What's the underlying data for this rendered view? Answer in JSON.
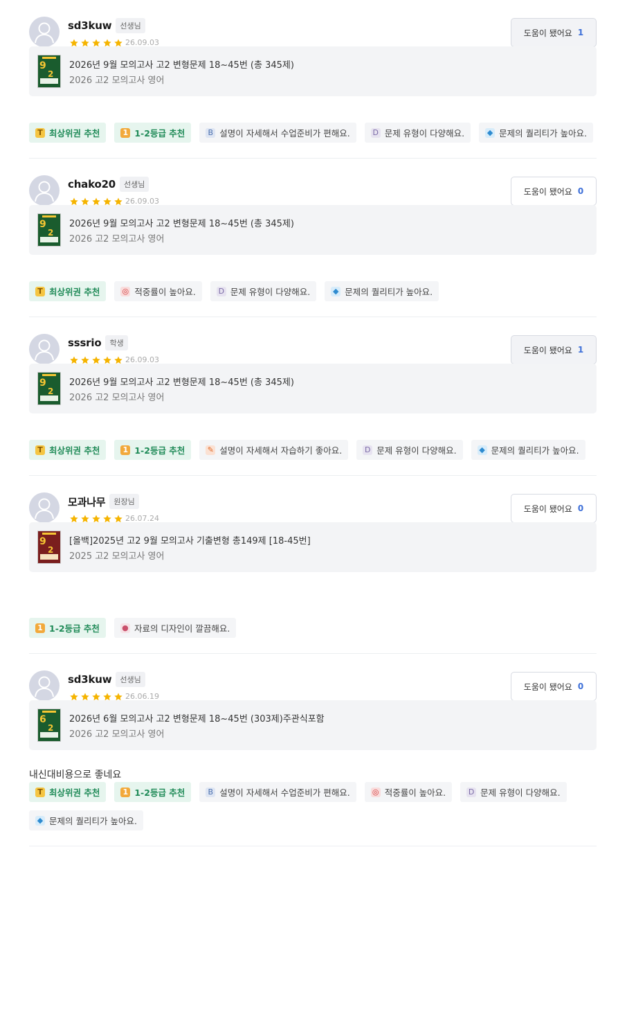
{
  "help_label": "도움이 됐어요",
  "reviews": [
    {
      "name": "sd3kuw",
      "role": "선생님",
      "date": "26.09.03",
      "rating": 5,
      "help_count": "1",
      "help_active": true,
      "product_title": "2026년 9월 모의고사 고2 변형문제 18~45번 (총 345제)",
      "product_subtitle": "2026 고2 모의고사 영어",
      "thumb_number": "9",
      "thumb_color": "green",
      "comment": "",
      "tags": [
        {
          "label": "최상위권 추천",
          "icon": "trophy-icon",
          "highlight": true
        },
        {
          "label": "1-2등급 추천",
          "icon": "medal-icon",
          "highlight": true
        },
        {
          "label": "설명이 자세해서 수업준비가 편해요.",
          "icon": "book-icon",
          "highlight": false
        },
        {
          "label": "문제 유형이 다양해요.",
          "icon": "dice-icon",
          "highlight": false
        },
        {
          "label": "문제의 퀄리티가 높아요.",
          "icon": "diamond-icon",
          "highlight": false
        }
      ]
    },
    {
      "name": "chako20",
      "role": "선생님",
      "date": "26.09.03",
      "rating": 5,
      "help_count": "0",
      "help_active": false,
      "product_title": "2026년 9월 모의고사 고2 변형문제 18~45번 (총 345제)",
      "product_subtitle": "2026 고2 모의고사 영어",
      "thumb_number": "9",
      "thumb_color": "green",
      "comment": "",
      "tags": [
        {
          "label": "최상위권 추천",
          "icon": "trophy-icon",
          "highlight": true
        },
        {
          "label": "적중률이 높아요.",
          "icon": "target-icon",
          "highlight": false
        },
        {
          "label": "문제 유형이 다양해요.",
          "icon": "dice-icon",
          "highlight": false
        },
        {
          "label": "문제의 퀄리티가 높아요.",
          "icon": "diamond-icon",
          "highlight": false
        }
      ]
    },
    {
      "name": "sssrio",
      "role": "학생",
      "date": "26.09.03",
      "rating": 5,
      "help_count": "1",
      "help_active": true,
      "product_title": "2026년 9월 모의고사 고2 변형문제 18~45번 (총 345제)",
      "product_subtitle": "2026 고2 모의고사 영어",
      "thumb_number": "9",
      "thumb_color": "green",
      "comment": "",
      "tags": [
        {
          "label": "최상위권 추천",
          "icon": "trophy-icon",
          "highlight": true
        },
        {
          "label": "1-2등급 추천",
          "icon": "medal-icon",
          "highlight": true
        },
        {
          "label": "설명이 자세해서 자습하기 좋아요.",
          "icon": "pencil-icon",
          "highlight": false
        },
        {
          "label": "문제 유형이 다양해요.",
          "icon": "dice-icon",
          "highlight": false
        },
        {
          "label": "문제의 퀄리티가 높아요.",
          "icon": "diamond-icon",
          "highlight": false
        }
      ]
    },
    {
      "name": "모과나무",
      "role": "원장님",
      "date": "26.07.24",
      "rating": 5,
      "help_count": "0",
      "help_active": false,
      "product_title": "[올백]2025년 고2 9월 모의고사 기출변형 총149제 [18-45번]",
      "product_subtitle": "2025 고2 모의고사 영어",
      "thumb_number": "9",
      "thumb_color": "red",
      "comment": " ",
      "tags": [
        {
          "label": "1-2등급 추천",
          "icon": "medal-icon",
          "highlight": true
        },
        {
          "label": "자료의 디자인이 깔끔해요.",
          "icon": "palette-icon",
          "highlight": false
        }
      ]
    },
    {
      "name": "sd3kuw",
      "role": "선생님",
      "date": "26.06.19",
      "rating": 5,
      "help_count": "0",
      "help_active": false,
      "product_title": "2026년 6월 모의고사 고2 변형문제 18~45번 (303제)주관식포함",
      "product_subtitle": "2026 고2 모의고사 영어",
      "thumb_number": "6",
      "thumb_color": "green",
      "comment": "내신대비용으로 좋네요",
      "tags": [
        {
          "label": "최상위권 추천",
          "icon": "trophy-icon",
          "highlight": true
        },
        {
          "label": "1-2등급 추천",
          "icon": "medal-icon",
          "highlight": true
        },
        {
          "label": "설명이 자세해서 수업준비가 편해요.",
          "icon": "book-icon",
          "highlight": false
        },
        {
          "label": "적중률이 높아요.",
          "icon": "target-icon",
          "highlight": false
        },
        {
          "label": "문제 유형이 다양해요.",
          "icon": "dice-icon",
          "highlight": false
        },
        {
          "label": "문제의 퀄리티가 높아요.",
          "icon": "diamond-icon",
          "highlight": false
        }
      ]
    }
  ]
}
